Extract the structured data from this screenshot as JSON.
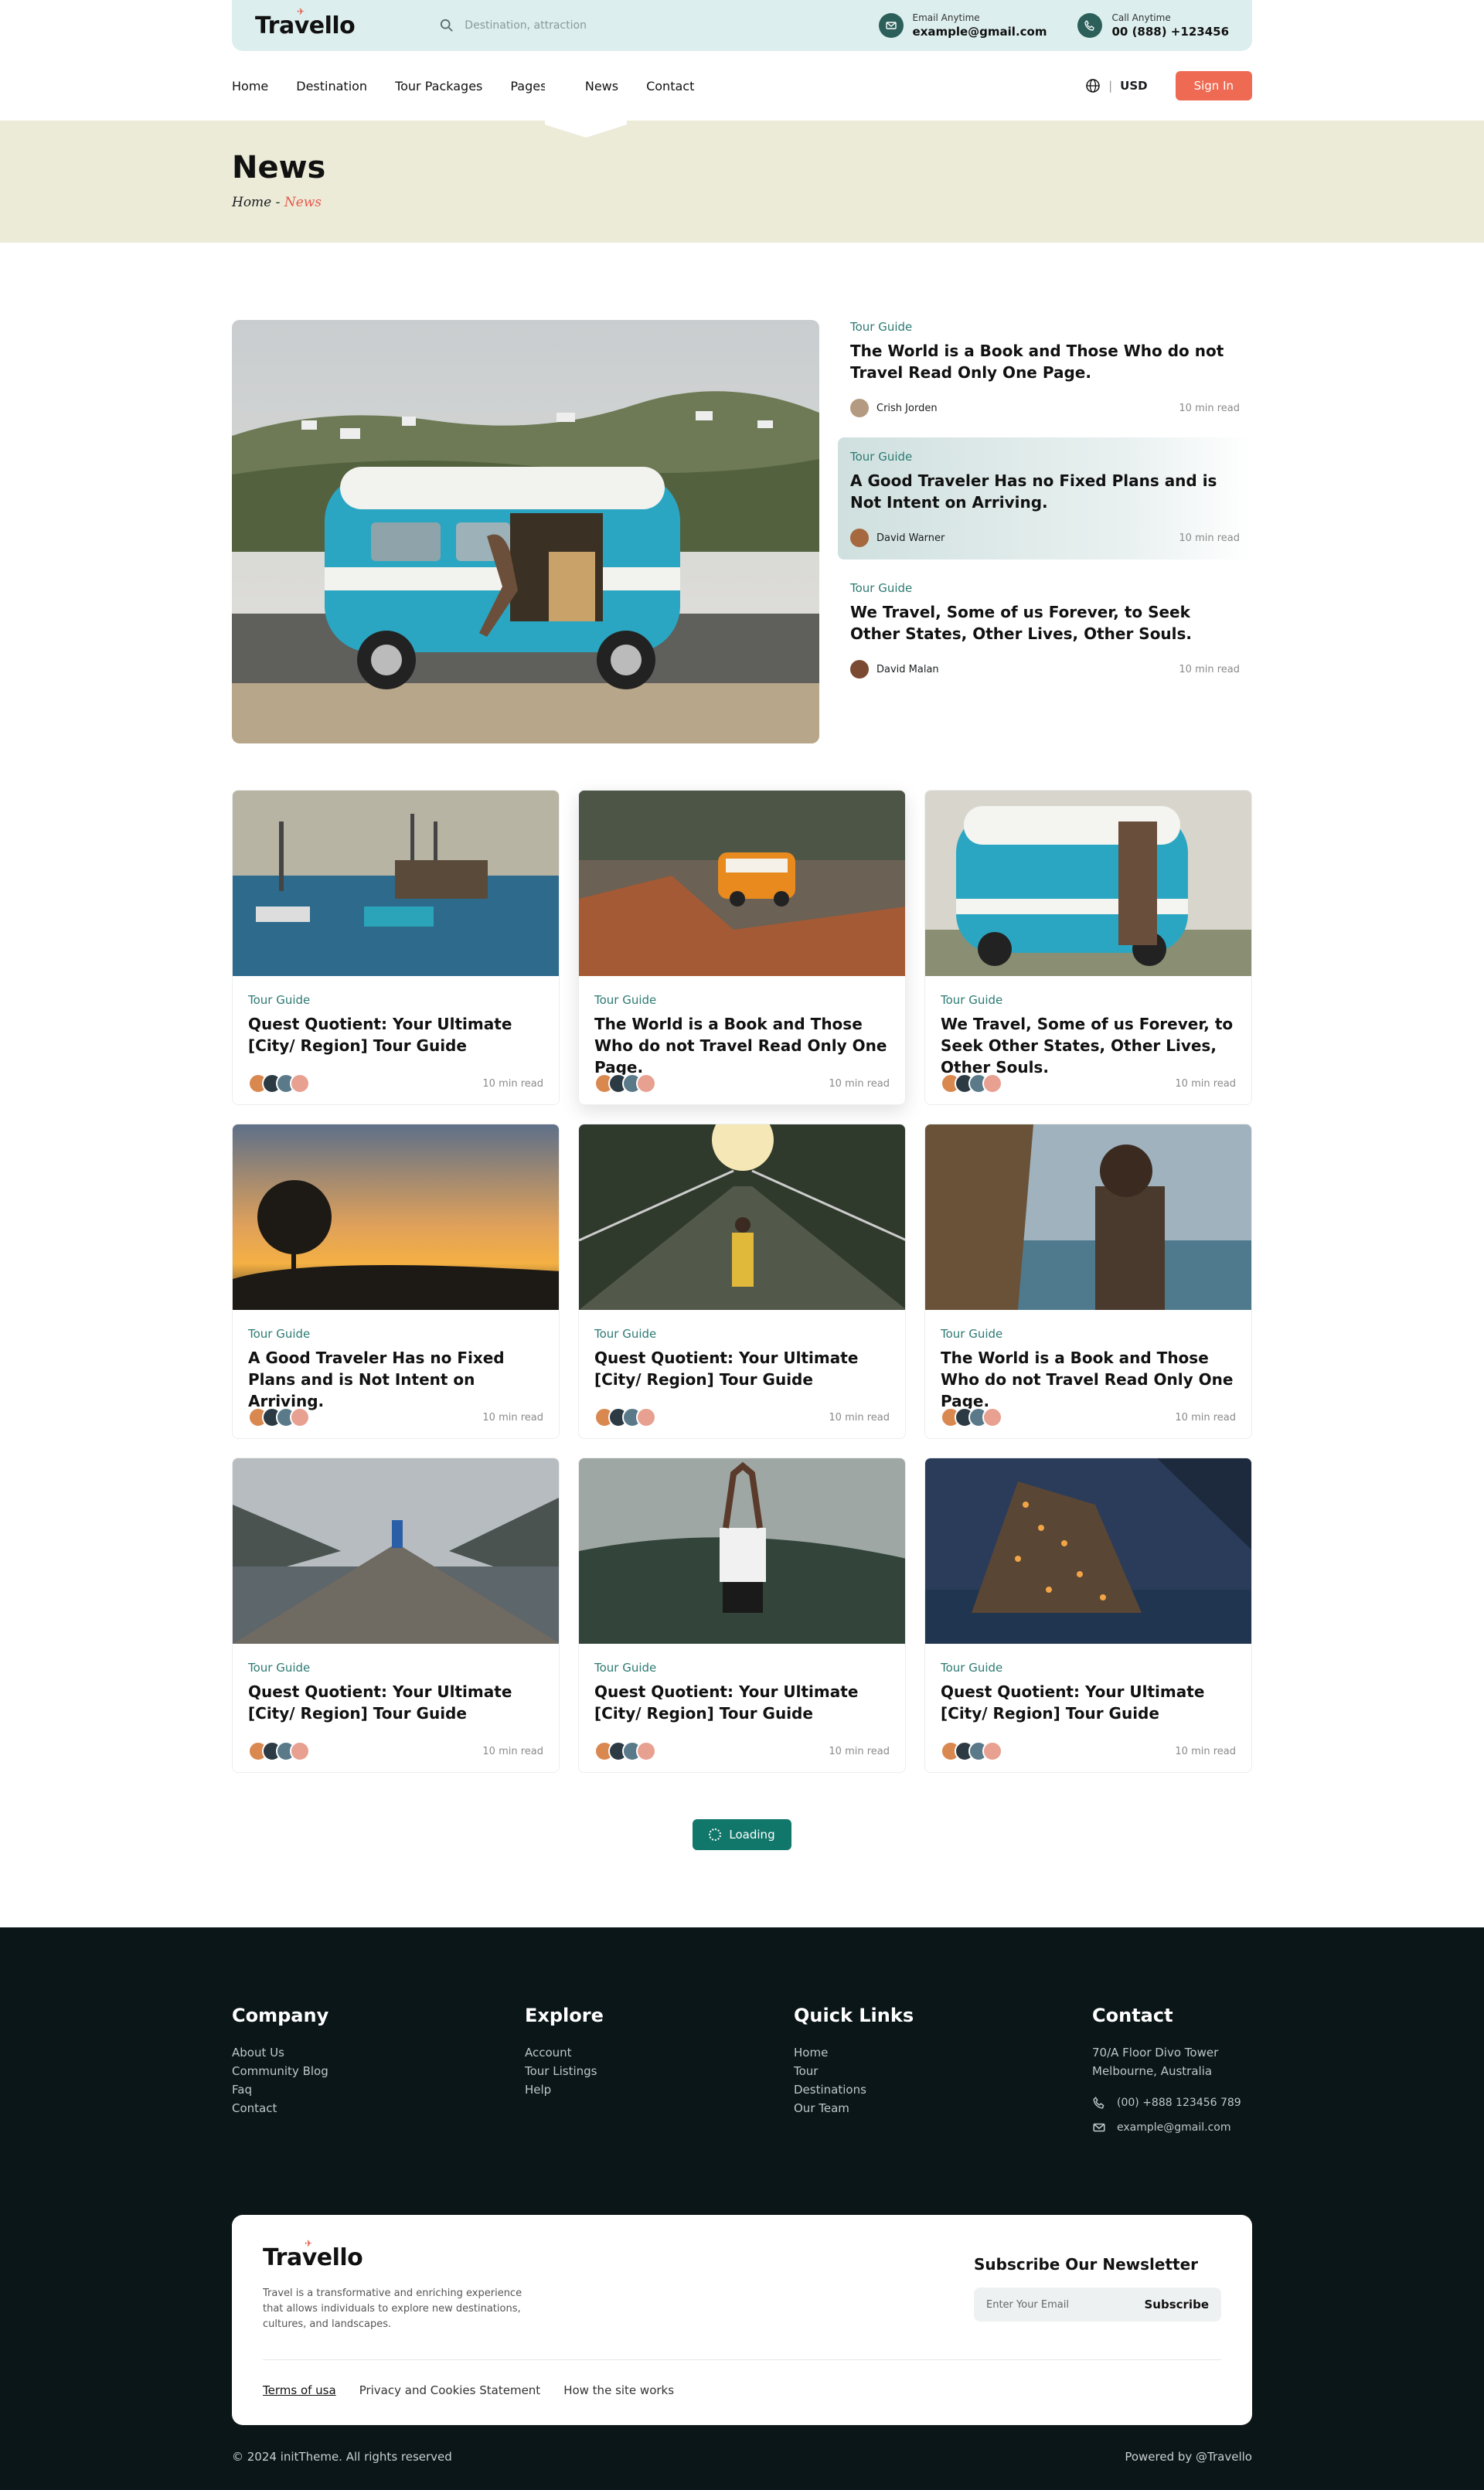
{
  "brand": {
    "name": "Travello"
  },
  "topbar": {
    "search_placeholder": "Destination, attraction",
    "email_label": "Email Anytime",
    "email_value": "example@gmail.com",
    "call_label": "Call Anytime",
    "call_value": "00 (888) +123456"
  },
  "nav": {
    "items": [
      "Home",
      "Destination",
      "Tour Packages",
      "Pages+",
      "News",
      "Contact"
    ],
    "currency": "USD",
    "sign_in": "Sign In"
  },
  "hero": {
    "title": "News",
    "crumb_home": "Home",
    "crumb_sep": " - ",
    "crumb_current": "News"
  },
  "featured": {
    "posts": [
      {
        "category": "Tour Guide",
        "title": "The World is a Book and Those Who do not Travel Read Only One Page.",
        "author": "Crish Jorden",
        "read": "10 min read"
      },
      {
        "category": "Tour Guide",
        "title": "A Good Traveler Has no Fixed Plans and is Not Intent on Arriving.",
        "author": "David Warner",
        "read": "10 min read"
      },
      {
        "category": "Tour Guide",
        "title": "We Travel, Some of us Forever, to Seek Other States, Other Lives, Other Souls.",
        "author": "David Malan",
        "read": "10 min read"
      }
    ]
  },
  "cards": [
    {
      "category": "Tour Guide",
      "title": "Quest Quotient: Your Ultimate [City/ Region] Tour Guide",
      "read": "10 min read"
    },
    {
      "category": "Tour Guide",
      "title": "The World is a Book and Those Who do not Travel Read Only One Page.",
      "read": "10 min read"
    },
    {
      "category": "Tour Guide",
      "title": "We Travel, Some of us Forever, to Seek Other States, Other Lives, Other Souls.",
      "read": "10 min read"
    },
    {
      "category": "Tour Guide",
      "title": "A Good Traveler Has no Fixed Plans and is Not Intent on Arriving.",
      "read": "10 min read"
    },
    {
      "category": "Tour Guide",
      "title": "Quest Quotient: Your Ultimate [City/ Region] Tour Guide",
      "read": "10 min read"
    },
    {
      "category": "Tour Guide",
      "title": "The World is a Book and Those Who do not Travel Read Only One Page.",
      "read": "10 min read"
    },
    {
      "category": "Tour Guide",
      "title": "Quest Quotient: Your Ultimate [City/ Region] Tour Guide",
      "read": "10 min read"
    },
    {
      "category": "Tour Guide",
      "title": "Quest Quotient: Your Ultimate [City/ Region] Tour Guide",
      "read": "10 min read"
    },
    {
      "category": "Tour Guide",
      "title": "Quest Quotient: Your Ultimate [City/ Region] Tour Guide",
      "read": "10 min read"
    }
  ],
  "loading": "Loading",
  "footer": {
    "company": {
      "title": "Company",
      "links": [
        "About Us",
        "Community Blog",
        "Faq",
        "Contact"
      ]
    },
    "explore": {
      "title": "Explore",
      "links": [
        "Account",
        "Tour Listings",
        "Help"
      ]
    },
    "quick": {
      "title": "Quick Links",
      "links": [
        "Home",
        "Tour",
        "Destinations",
        "Our Team"
      ]
    },
    "contact": {
      "title": "Contact",
      "address1": "70/A Floor Divo Tower",
      "address2": "Melbourne, Australia",
      "phone": "(00) +888 123456 789",
      "email": "example@gmail.com"
    },
    "about": "Travel is a transformative and enriching experience that allows individuals to explore new destinations, cultures, and landscapes.",
    "newsletter_title": "Subscribe Our Newsletter",
    "newsletter_placeholder": "Enter Your Email",
    "subscribe": "Subscribe",
    "bottom_links": [
      "Terms of usa",
      "Privacy and Cookies Statement",
      "How the site works"
    ],
    "copyright": "© 2024 initTheme. All rights reserved",
    "powered": "Powered by @Travello"
  },
  "colors": {
    "accent": "#2c7a72",
    "brand_red": "#ef6a52",
    "footer_bg": "#0b1618",
    "hero_bg": "#ecebd8"
  }
}
